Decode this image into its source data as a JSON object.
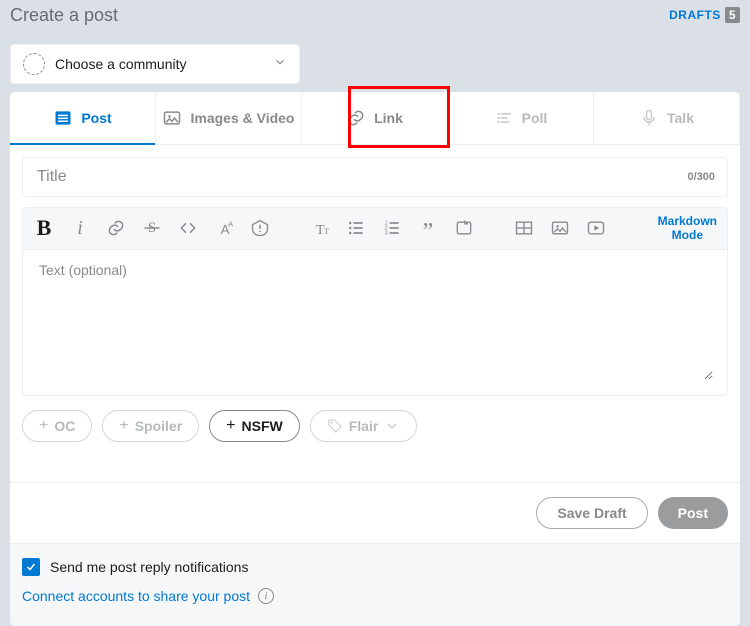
{
  "header": {
    "title": "Create a post",
    "drafts_label": "DRAFTS",
    "drafts_count": "5"
  },
  "community": {
    "placeholder": "Choose a community"
  },
  "tabs": [
    {
      "id": "post",
      "label": "Post",
      "active": true,
      "disabled": false
    },
    {
      "id": "images",
      "label": "Images & Video",
      "active": false,
      "disabled": false
    },
    {
      "id": "link",
      "label": "Link",
      "active": false,
      "disabled": false,
      "highlighted": true
    },
    {
      "id": "poll",
      "label": "Poll",
      "active": false,
      "disabled": true
    },
    {
      "id": "talk",
      "label": "Talk",
      "active": false,
      "disabled": true
    }
  ],
  "title_field": {
    "placeholder": "Title",
    "counter": "0/300"
  },
  "editor": {
    "markdown_toggle": "Markdown\nMode",
    "body_placeholder": "Text (optional)"
  },
  "tags": {
    "oc": "OC",
    "spoiler": "Spoiler",
    "nsfw": "NSFW",
    "flair": "Flair"
  },
  "actions": {
    "save_draft": "Save Draft",
    "post": "Post"
  },
  "footer": {
    "notify_label": "Send me post reply notifications",
    "notify_checked": true,
    "connect_label": "Connect accounts to share your post"
  }
}
